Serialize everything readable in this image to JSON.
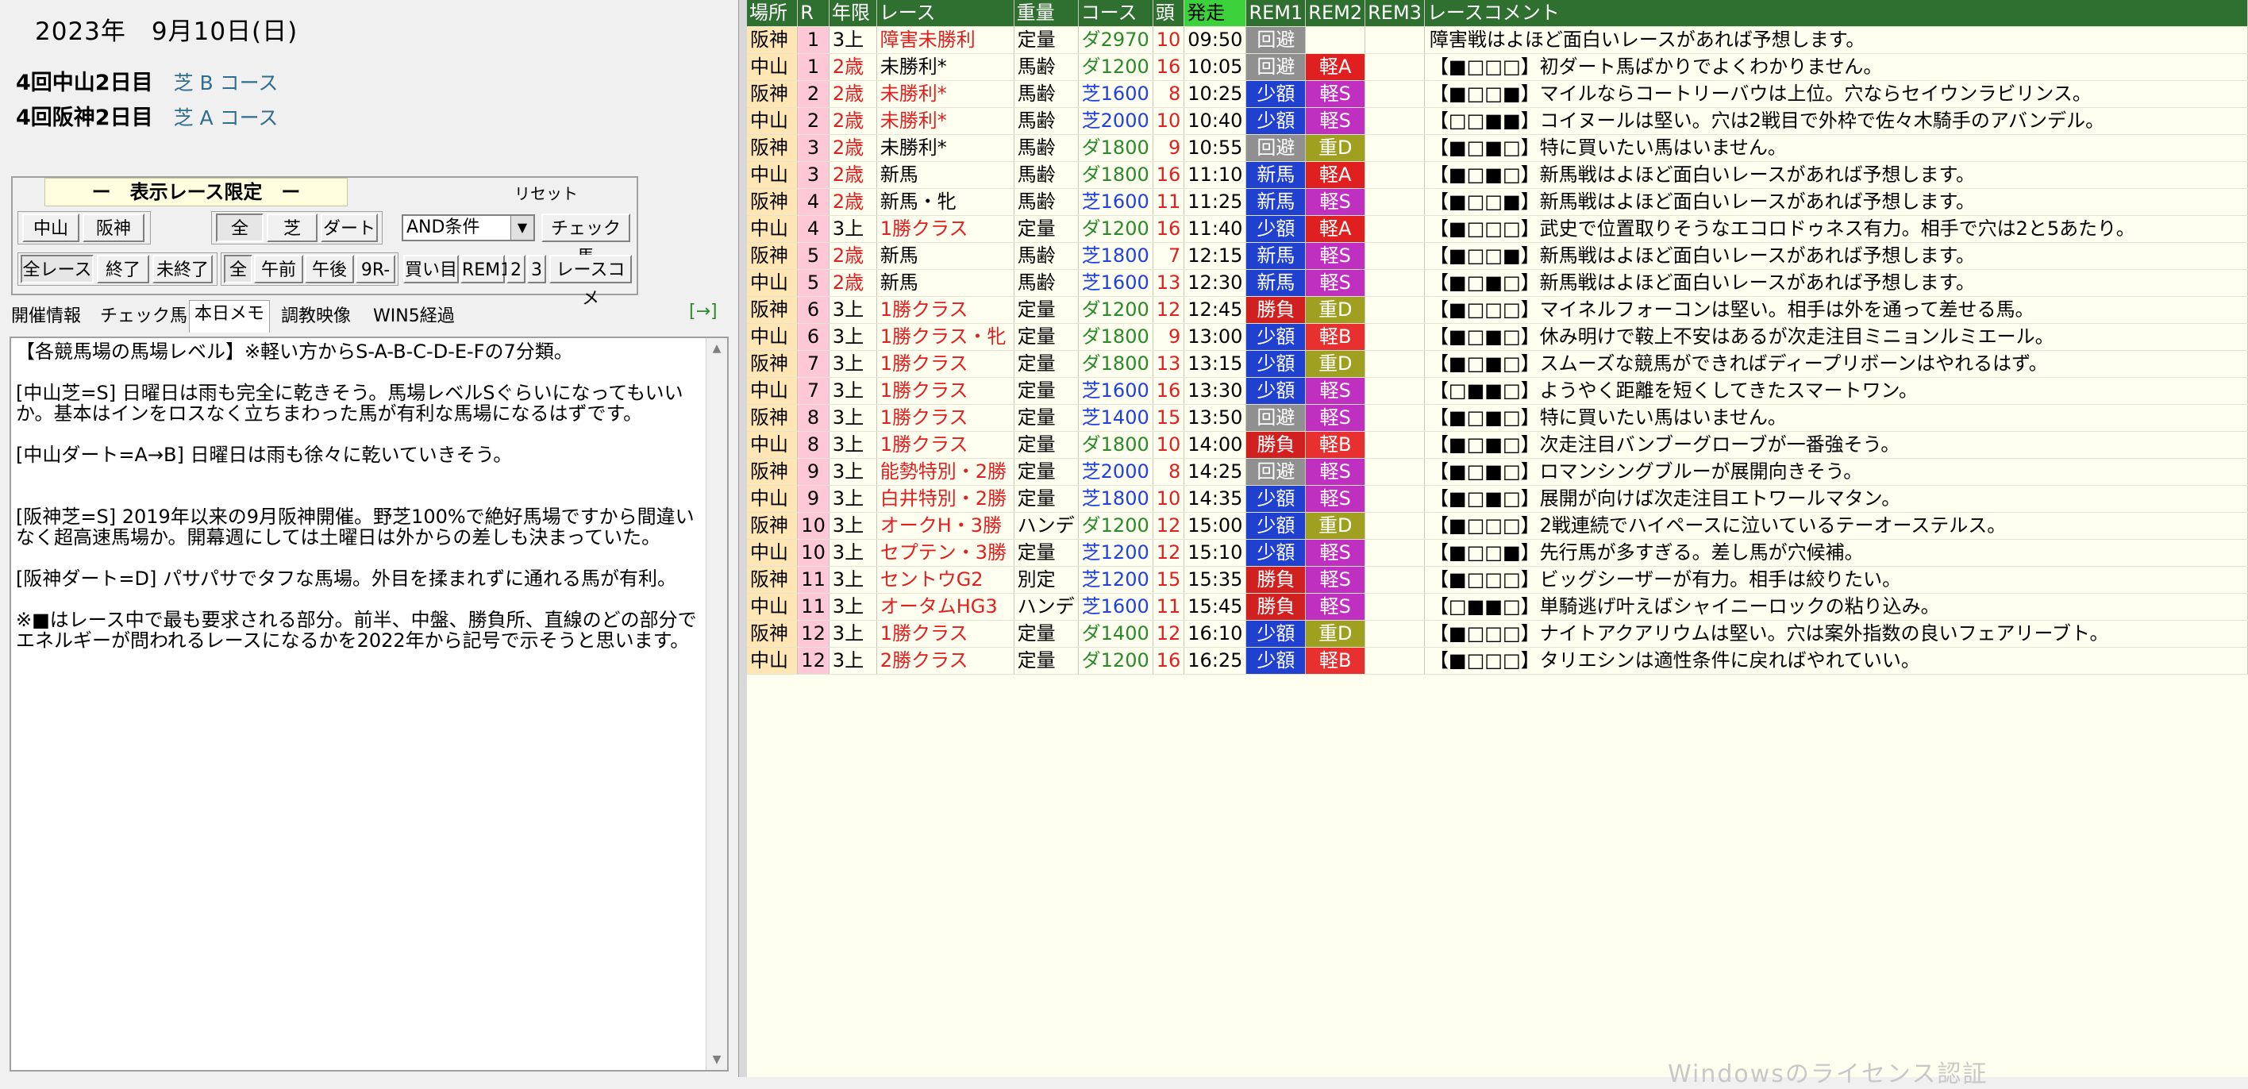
{
  "date": "2023年　9月10日(日)",
  "meetings": [
    {
      "name": "4回中山2日目",
      "cond": "芝 B コース"
    },
    {
      "name": "4回阪神2日目",
      "cond": "芝 A コース"
    }
  ],
  "filter": {
    "title": "ー　表示レース限定　ー",
    "reset": "リセット",
    "venue_buttons": [
      "中山",
      "阪神"
    ],
    "surface_buttons": [
      "全",
      "芝",
      "ダート"
    ],
    "condition_select": "AND条件",
    "check_button": "チェック馬",
    "status_buttons": [
      "全レース",
      "終了",
      "未終了"
    ],
    "time_buttons": [
      "全",
      "午前",
      "午後",
      "9R-"
    ],
    "misc_buttons": [
      "買い目",
      "REM1",
      "2",
      "3",
      "レースコメ"
    ]
  },
  "tabs": [
    "開催情報",
    "チェック馬",
    "本日メモ",
    "調教映像",
    "WIN5経過"
  ],
  "tab_arrow": "[→]",
  "memo": "【各競馬場の馬場レベル】※軽い方からS-A-B-C-D-E-Fの7分類。\n\n[中山芝=S] 日曜日は雨も完全に乾きそう。馬場レベルSぐらいになってもいいか。基本はインをロスなく立ちまわった馬が有利な馬場になるはずです。\n\n[中山ダート=A→B] 日曜日は雨も徐々に乾いていきそう。\n\n\n[阪神芝=S] 2019年以来の9月阪神開催。野芝100%で絶好馬場ですから間違いなく超高速馬場か。開幕週にしては土曜日は外からの差しも決まっていた。\n\n[阪神ダート=D] パサパサでタフな馬場。外目を揉まれずに通れる馬が有利。\n\n※■はレース中で最も要求される部分。前半、中盤、勝負所、直線のどの部分でエネルギーが問われるレースになるかを2022年から記号で示そうと思います。",
  "grid": {
    "headers": [
      "場所",
      "R",
      "年限",
      "レース",
      "重量",
      "コース",
      "頭",
      "発走",
      "REM1",
      "REM2",
      "REM3",
      "レースコメント"
    ],
    "rows": [
      {
        "place": "阪神",
        "r": "1",
        "age": "3上",
        "race": "障害未勝利",
        "race_red": true,
        "weight": "定量",
        "course": "ダ2970",
        "surf": "dirt",
        "heads": "10",
        "time": "09:50",
        "rem1": "回避",
        "rem2": "",
        "comment": "障害戦はよほど面白いレースがあれば予想します。"
      },
      {
        "place": "中山",
        "r": "1",
        "age": "2歳",
        "race": "未勝利*",
        "race_red": false,
        "weight": "馬齢",
        "course": "ダ1200",
        "surf": "dirt",
        "heads": "16",
        "time": "10:05",
        "rem1": "回避",
        "rem2": "軽A",
        "comment": "【■□□□】初ダート馬ばかりでよくわかりません。"
      },
      {
        "place": "阪神",
        "r": "2",
        "age": "2歳",
        "race": "未勝利*",
        "race_red": true,
        "weight": "馬齢",
        "course": "芝1600",
        "surf": "turf",
        "heads": "8",
        "time": "10:25",
        "rem1": "少額",
        "rem2": "軽S",
        "comment": "【■□□■】マイルならコートリーバウは上位。穴ならセイウンラビリンス。"
      },
      {
        "place": "中山",
        "r": "2",
        "age": "2歳",
        "race": "未勝利*",
        "race_red": true,
        "weight": "馬齢",
        "course": "芝2000",
        "surf": "turf",
        "heads": "10",
        "time": "10:40",
        "rem1": "少額",
        "rem2": "軽S",
        "comment": "【□□■■】コイヌールは堅い。穴は2戦目で外枠で佐々木騎手のアバンデル。"
      },
      {
        "place": "阪神",
        "r": "3",
        "age": "2歳",
        "race": "未勝利*",
        "race_red": false,
        "weight": "馬齢",
        "course": "ダ1800",
        "surf": "dirt",
        "heads": "9",
        "time": "10:55",
        "rem1": "回避",
        "rem2": "重D",
        "comment": "【■□■□】特に買いたい馬はいません。"
      },
      {
        "place": "中山",
        "r": "3",
        "age": "2歳",
        "race": "新馬",
        "race_red": false,
        "weight": "馬齢",
        "course": "ダ1800",
        "surf": "dirt",
        "heads": "16",
        "time": "11:10",
        "rem1": "新馬",
        "rem2": "軽A",
        "comment": "【■□■□】新馬戦はよほど面白いレースがあれば予想します。"
      },
      {
        "place": "阪神",
        "r": "4",
        "age": "2歳",
        "race": "新馬・牝",
        "race_red": false,
        "weight": "馬齢",
        "course": "芝1600",
        "surf": "turf",
        "heads": "11",
        "time": "11:25",
        "rem1": "新馬",
        "rem2": "軽S",
        "comment": "【■□□■】新馬戦はよほど面白いレースがあれば予想します。"
      },
      {
        "place": "中山",
        "r": "4",
        "age": "3上",
        "race": "1勝クラス",
        "race_red": true,
        "weight": "定量",
        "course": "ダ1200",
        "surf": "dirt",
        "heads": "16",
        "time": "11:40",
        "rem1": "少額",
        "rem2": "軽A",
        "comment": "【■□□□】武史で位置取りそうなエコロドゥネス有力。相手で穴は2と5あたり。"
      },
      {
        "place": "阪神",
        "r": "5",
        "age": "2歳",
        "race": "新馬",
        "race_red": false,
        "weight": "馬齢",
        "course": "芝1800",
        "surf": "turf",
        "heads": "7",
        "time": "12:15",
        "rem1": "新馬",
        "rem2": "軽S",
        "comment": "【■□□■】新馬戦はよほど面白いレースがあれば予想します。"
      },
      {
        "place": "中山",
        "r": "5",
        "age": "2歳",
        "race": "新馬",
        "race_red": false,
        "weight": "馬齢",
        "course": "芝1600",
        "surf": "turf",
        "heads": "13",
        "time": "12:30",
        "rem1": "新馬",
        "rem2": "軽S",
        "comment": "【■□■□】新馬戦はよほど面白いレースがあれば予想します。"
      },
      {
        "place": "阪神",
        "r": "6",
        "age": "3上",
        "race": "1勝クラス",
        "race_red": true,
        "weight": "定量",
        "course": "ダ1200",
        "surf": "dirt",
        "heads": "12",
        "time": "12:45",
        "rem1": "勝負",
        "rem2": "重D",
        "comment": "【■□□□】マイネルフォーコンは堅い。相手は外を通って差せる馬。"
      },
      {
        "place": "中山",
        "r": "6",
        "age": "3上",
        "race": "1勝クラス・牝",
        "race_red": true,
        "weight": "定量",
        "course": "ダ1800",
        "surf": "dirt",
        "heads": "9",
        "time": "13:00",
        "rem1": "少額",
        "rem2": "軽B",
        "comment": "【■□■□】休み明けで鞍上不安はあるが次走注目ミニョンルミエール。"
      },
      {
        "place": "阪神",
        "r": "7",
        "age": "3上",
        "race": "1勝クラス",
        "race_red": true,
        "weight": "定量",
        "course": "ダ1800",
        "surf": "dirt",
        "heads": "13",
        "time": "13:15",
        "rem1": "少額",
        "rem2": "重D",
        "comment": "【■□■□】スムーズな競馬ができればディープリボーンはやれるはず。"
      },
      {
        "place": "中山",
        "r": "7",
        "age": "3上",
        "race": "1勝クラス",
        "race_red": true,
        "weight": "定量",
        "course": "芝1600",
        "surf": "turf",
        "heads": "16",
        "time": "13:30",
        "rem1": "少額",
        "rem2": "軽S",
        "comment": "【□■■□】ようやく距離を短くしてきたスマートワン。"
      },
      {
        "place": "阪神",
        "r": "8",
        "age": "3上",
        "race": "1勝クラス",
        "race_red": true,
        "weight": "定量",
        "course": "芝1400",
        "surf": "turf",
        "heads": "15",
        "time": "13:50",
        "rem1": "回避",
        "rem2": "軽S",
        "comment": "【■□■□】特に買いたい馬はいません。"
      },
      {
        "place": "中山",
        "r": "8",
        "age": "3上",
        "race": "1勝クラス",
        "race_red": true,
        "weight": "定量",
        "course": "ダ1800",
        "surf": "dirt",
        "heads": "10",
        "time": "14:00",
        "rem1": "勝負",
        "rem2": "軽B",
        "comment": "【■□■□】次走注目バンブーグローブが一番強そう。"
      },
      {
        "place": "阪神",
        "r": "9",
        "age": "3上",
        "race": "能勢特別・2勝",
        "race_red": true,
        "weight": "定量",
        "course": "芝2000",
        "surf": "turf",
        "heads": "8",
        "time": "14:25",
        "rem1": "回避",
        "rem2": "軽S",
        "comment": "【■□■□】ロマンシングブルーが展開向きそう。"
      },
      {
        "place": "中山",
        "r": "9",
        "age": "3上",
        "race": "白井特別・2勝",
        "race_red": true,
        "weight": "定量",
        "course": "芝1800",
        "surf": "turf",
        "heads": "10",
        "time": "14:35",
        "rem1": "少額",
        "rem2": "軽S",
        "comment": "【■□■□】展開が向けば次走注目エトワールマタン。"
      },
      {
        "place": "阪神",
        "r": "10",
        "age": "3上",
        "race": "オークH・3勝",
        "race_red": true,
        "weight": "ハンデ",
        "course": "ダ1200",
        "surf": "dirt",
        "heads": "12",
        "time": "15:00",
        "rem1": "少額",
        "rem2": "重D",
        "comment": "【■□□□】2戦連続でハイペースに泣いているテーオーステルス。"
      },
      {
        "place": "中山",
        "r": "10",
        "age": "3上",
        "race": "セプテン・3勝",
        "race_red": true,
        "weight": "定量",
        "course": "芝1200",
        "surf": "turf",
        "heads": "12",
        "time": "15:10",
        "rem1": "少額",
        "rem2": "軽S",
        "comment": "【■□□■】先行馬が多すぎる。差し馬が穴候補。"
      },
      {
        "place": "阪神",
        "r": "11",
        "age": "3上",
        "race": "セントウG2",
        "race_red": true,
        "weight": "別定",
        "course": "芝1200",
        "surf": "turf",
        "heads": "15",
        "time": "15:35",
        "rem1": "勝負",
        "rem2": "軽S",
        "comment": "【■□□□】ビッグシーザーが有力。相手は絞りたい。"
      },
      {
        "place": "中山",
        "r": "11",
        "age": "3上",
        "race": "オータムHG3",
        "race_red": true,
        "weight": "ハンデ",
        "course": "芝1600",
        "surf": "turf",
        "heads": "11",
        "time": "15:45",
        "rem1": "勝負",
        "rem2": "軽S",
        "comment": "【□■■□】単騎逃げ叶えばシャイニーロックの粘り込み。"
      },
      {
        "place": "阪神",
        "r": "12",
        "age": "3上",
        "race": "1勝クラス",
        "race_red": true,
        "weight": "定量",
        "course": "ダ1400",
        "surf": "dirt",
        "heads": "12",
        "time": "16:10",
        "rem1": "少額",
        "rem2": "重D",
        "comment": "【■□□□】ナイトアクアリウムは堅い。穴は案外指数の良いフェアリーブト。"
      },
      {
        "place": "中山",
        "r": "12",
        "age": "3上",
        "race": "2勝クラス",
        "race_red": true,
        "weight": "定量",
        "course": "ダ1200",
        "surf": "dirt",
        "heads": "16",
        "time": "16:25",
        "rem1": "少額",
        "rem2": "軽B",
        "comment": "【■□□□】タリエシンは適性条件に戻ればやれていい。"
      }
    ]
  },
  "watermark": "Windowsのライセンス認証",
  "colors": {
    "header_bg": "#2f6f2f",
    "header_highlight": "#3cd23c",
    "place_bg": "#ffe6b4",
    "r_bg": "#ffc8d6",
    "grid_bg": "#fffff0",
    "rem1": {
      "回避": "#909090",
      "少額": "#2040d0",
      "新馬": "#2040d0",
      "勝負": "#d02020"
    },
    "rem2": {
      "軽A": "#e02020",
      "軽S": "#c030c0",
      "重D": "#a0a020",
      "軽B": "#e83030"
    }
  }
}
